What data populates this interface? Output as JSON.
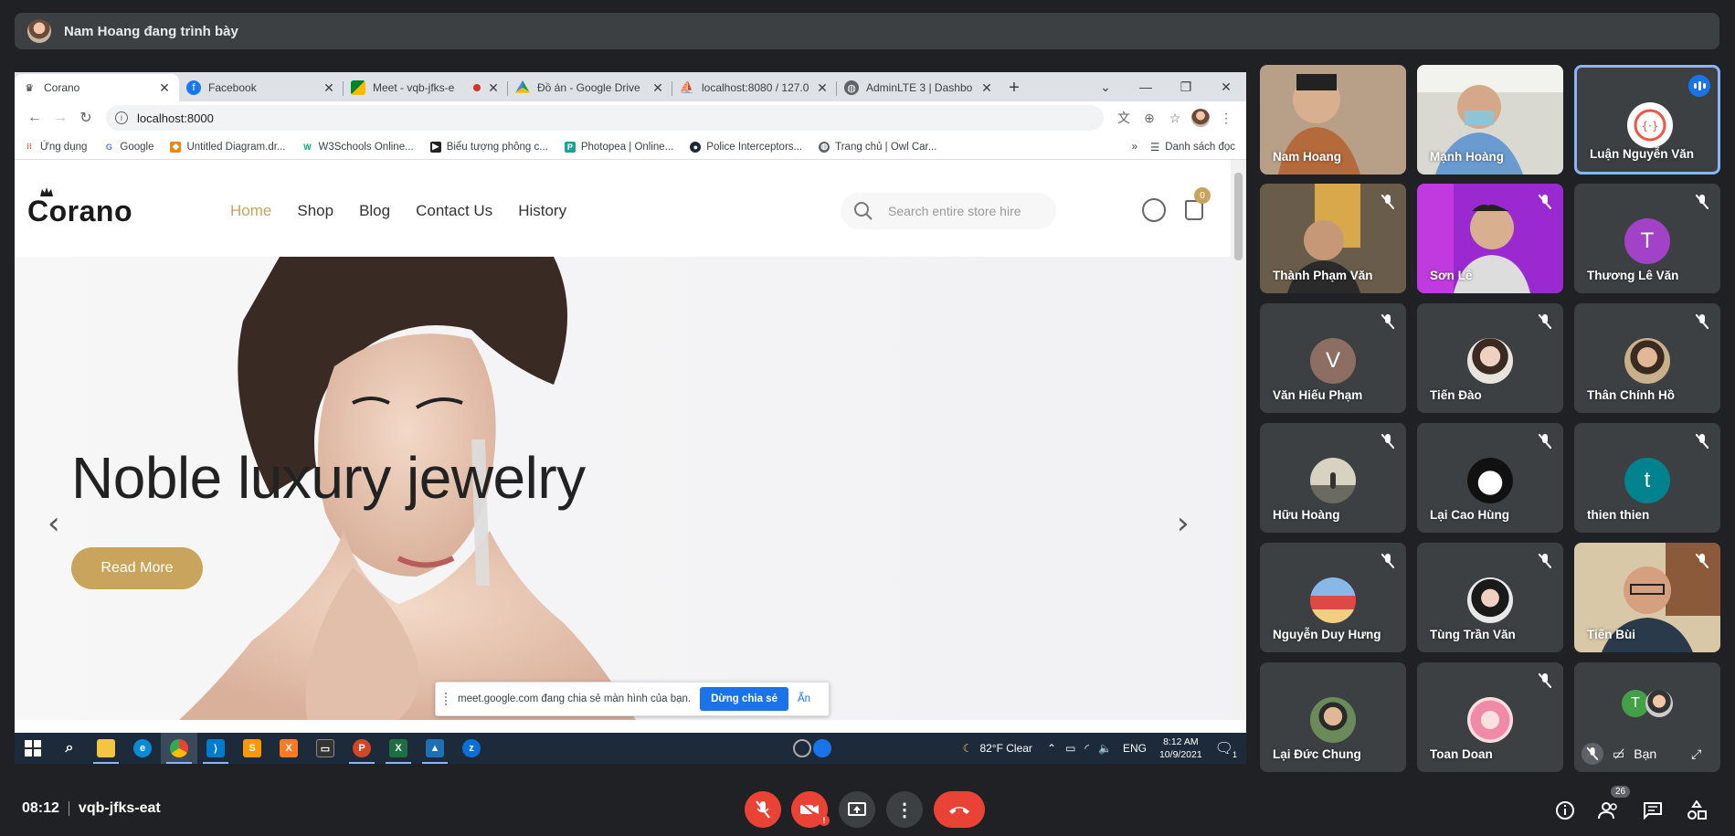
{
  "presenter": {
    "text": "Nam Hoang đang trình bày"
  },
  "browser": {
    "tabs": [
      {
        "title": "Corano",
        "active": true
      },
      {
        "title": "Facebook"
      },
      {
        "title": "Meet - vqb-jfks-e",
        "recording": true
      },
      {
        "title": "Đồ án - Google Drive"
      },
      {
        "title": "localhost:8080 / 127.0"
      },
      {
        "title": "AdminLTE 3 | Dashbo"
      }
    ],
    "address": "localhost:8000",
    "bookmarks": [
      "Ứng dụng",
      "Google",
      "Untitled Diagram.dr...",
      "W3Schools Online...",
      "Biểu tượng phông c...",
      "Photopea | Online...",
      "Police Interceptors...",
      "Trang chủ | Owl Car..."
    ],
    "reading_list": "Danh sách đọc"
  },
  "site": {
    "logo": "Corano",
    "menu": [
      "Home",
      "Shop",
      "Blog",
      "Contact Us",
      "History"
    ],
    "search_placeholder": "Search entire store hire",
    "cart_count": "0",
    "hero_title": "Noble luxury jewelry",
    "hero_button": "Read More",
    "accent_color": "#c9a45c"
  },
  "share_banner": {
    "message": "meet.google.com đang chia sẻ màn hình của bạn.",
    "stop_label": "Dừng chia sẻ",
    "hide_label": "Ẩn"
  },
  "taskbar": {
    "weather": "82°F  Clear",
    "lang": "ENG",
    "time": "8:12 AM",
    "date": "10/9/2021",
    "notification_count": "1"
  },
  "participants": [
    {
      "name": "Nam Hoang"
    },
    {
      "name": "Mạnh Hoàng"
    },
    {
      "name": "Luận Nguyễn Văn"
    },
    {
      "name": "Thành Phạm Văn"
    },
    {
      "name": "Sơn Lê"
    },
    {
      "name": "Thương Lê Văn",
      "initial": "T"
    },
    {
      "name": "Văn Hiếu Phạm",
      "initial": "V"
    },
    {
      "name": "Tiến Đào"
    },
    {
      "name": "Thân Chính Hồ"
    },
    {
      "name": "Hữu Hoàng"
    },
    {
      "name": "Lại Cao Hùng"
    },
    {
      "name": "thien thien",
      "initial": "t"
    },
    {
      "name": "Nguyễn Duy Hưng"
    },
    {
      "name": "Tùng Trần Văn"
    },
    {
      "name": "Tiến Bùi"
    },
    {
      "name": "Lại Đức Chung"
    },
    {
      "name": "Toan Doan"
    },
    {
      "name": "Bạn",
      "initial": "T"
    }
  ],
  "meeting": {
    "time": "08:12",
    "code": "vqb-jfks-eat",
    "participant_count": "26"
  }
}
